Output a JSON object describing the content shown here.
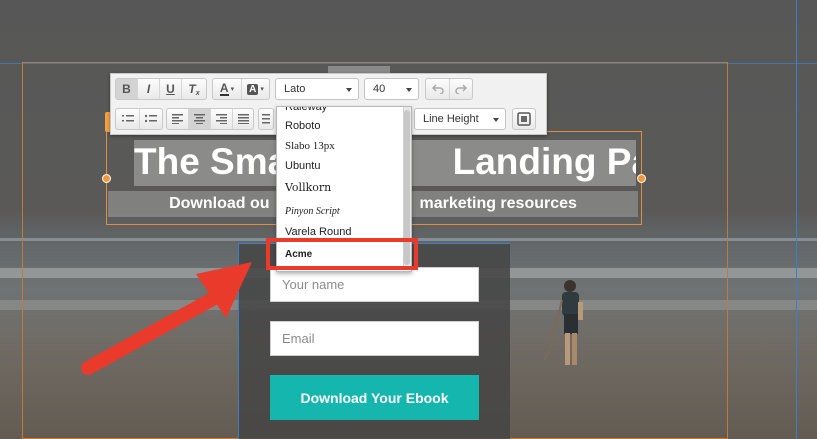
{
  "colors": {
    "accent_orange": "#f0a040",
    "guide_blue": "#3d7fc4",
    "cta_teal": "#14b6ad",
    "annotation_red": "#ea3a2b"
  },
  "headline": {
    "left": "The Smar",
    "right": "Landing Page",
    "sub_left": "Download ou",
    "sub_right": "marketing resources"
  },
  "form": {
    "name_placeholder": "Your name",
    "email_placeholder": "Email",
    "cta_label": "Download Your Ebook"
  },
  "toolbar": {
    "bold": "B",
    "italic": "I",
    "underline": "U",
    "clear_format": "T",
    "font_color": "A",
    "highlight_color": "A",
    "font_family": "Lato",
    "font_size": "40",
    "line_height": "Line Height"
  },
  "font_dropdown": {
    "items": [
      "Raleway",
      "Roboto",
      "Slabo 13px",
      "Ubuntu",
      "Vollkorn",
      "Pinyon Script",
      "Varela Round",
      "Acme"
    ]
  },
  "icons": {
    "undo": "undo-icon",
    "redo": "redo-icon",
    "bulleted_list": "bulleted-list-icon",
    "numbered_list": "numbered-list-icon",
    "align_left": "align-left-icon",
    "align_center": "align-center-icon",
    "align_right": "align-right-icon",
    "align_justify": "align-justify-icon",
    "image": "image-icon"
  }
}
